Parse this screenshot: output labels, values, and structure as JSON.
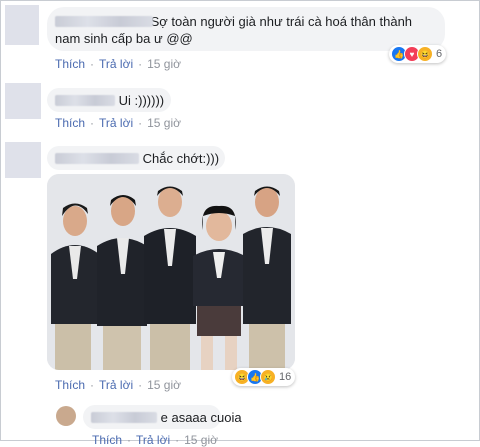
{
  "comments": [
    {
      "text_line1": "Sợ         toàn người già như trái cà hoá thân thành",
      "text_line2": "nam sinh cấp ba ư @@",
      "name_suffix": "y",
      "reactions": {
        "count": "6",
        "icons": [
          "like-icon",
          "love-icon",
          "haha-icon"
        ]
      },
      "actions": {
        "like": "Thích",
        "reply": "Trả lời",
        "time": "15 giờ"
      }
    },
    {
      "text": "Ui :))))))",
      "name_suffix": "n",
      "actions": {
        "like": "Thích",
        "reply": "Trả lời",
        "time": "15 giờ"
      }
    },
    {
      "text": "Chắc chớt:)))",
      "actions": {
        "like": "Thích",
        "reply": "Trả lời",
        "time": "15 giờ"
      },
      "reactions": {
        "count": "16",
        "icons": [
          "haha-icon",
          "like-icon",
          "sad-icon"
        ]
      }
    },
    {
      "text": "e asaaa cuoia",
      "actions": {
        "like": "Thích",
        "reply": "Trả lời",
        "time": "15 giờ"
      }
    }
  ],
  "colors": {
    "link": "#4b6bb0",
    "bubble": "#f2f3f5",
    "time": "#90949c",
    "like": "#1877f2"
  }
}
